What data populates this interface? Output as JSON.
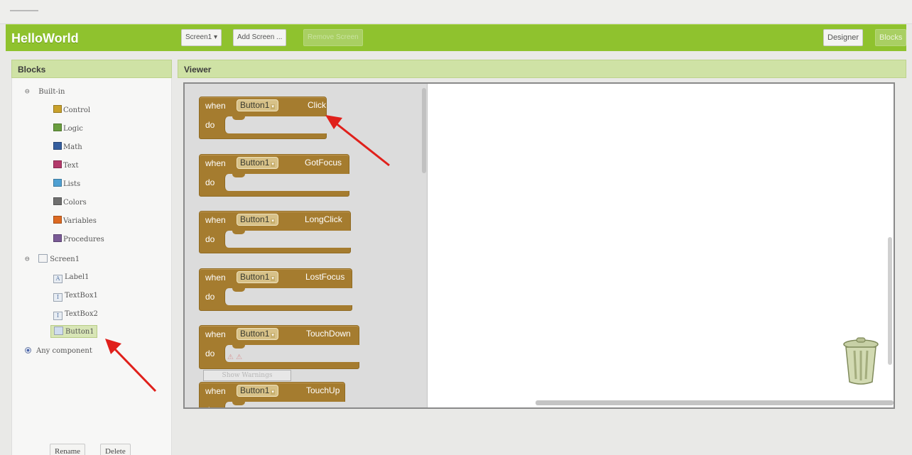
{
  "app": {
    "title": "HelloWorld"
  },
  "toolbar": {
    "screen_select": "Screen1 ▾",
    "add_screen": "Add Screen ...",
    "remove_screen": "Remove Screen",
    "designer": "Designer",
    "blocks": "Blocks"
  },
  "panels": {
    "blocks_header": "Blocks",
    "viewer_header": "Viewer"
  },
  "tree": {
    "builtin": {
      "label": "Built-in",
      "items": [
        {
          "label": "Control",
          "color": "#c9a12b"
        },
        {
          "label": "Logic",
          "color": "#6a9e3f"
        },
        {
          "label": "Math",
          "color": "#355e9e"
        },
        {
          "label": "Text",
          "color": "#b33a6b"
        },
        {
          "label": "Lists",
          "color": "#4fa0d2"
        },
        {
          "label": "Colors",
          "color": "#6f6f6f"
        },
        {
          "label": "Variables",
          "color": "#dd6a22"
        },
        {
          "label": "Procedures",
          "color": "#7a5a96"
        }
      ]
    },
    "screen": {
      "label": "Screen1",
      "items": [
        {
          "label": "Label1",
          "icon": "A"
        },
        {
          "label": "TextBox1",
          "icon": "I"
        },
        {
          "label": "TextBox2",
          "icon": "I"
        },
        {
          "label": "Button1",
          "icon": "☐",
          "selected": true
        }
      ]
    },
    "any_component": "Any component"
  },
  "left_buttons": {
    "rename": "Rename",
    "delete": "Delete"
  },
  "blocks": {
    "when": "when",
    "do": "do",
    "component": "Button1",
    "dropdown_arrow": "▾",
    "events": [
      "Click",
      "GotFocus",
      "LongClick",
      "LostFocus",
      "TouchDown",
      "TouchUp"
    ]
  },
  "warning": {
    "button": "Show Warnings",
    "marks": "⚠ ⚠"
  },
  "icons": {
    "trash": "trash-can-icon",
    "arrow": "red-arrow-annotation"
  },
  "colors": {
    "header_green": "#8fc22e",
    "panel_header": "#cfe2a5",
    "event_block": "#a57c2f",
    "annotation_red": "#e0201b"
  }
}
